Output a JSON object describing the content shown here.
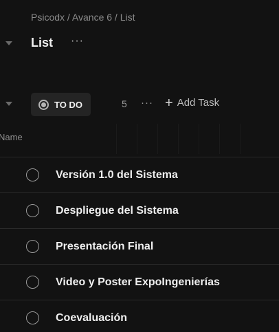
{
  "breadcrumb": "Psicodx / Avance 6 / List",
  "list": {
    "title": "List",
    "more": "···"
  },
  "group": {
    "status": "TO DO",
    "count": "5",
    "more": "···",
    "add_task": "Add Task",
    "add_icon": "+"
  },
  "columns": {
    "name": "Name"
  },
  "tasks": [
    {
      "name": "Versión 1.0 del Sistema"
    },
    {
      "name": "Despliegue del Sistema"
    },
    {
      "name": "Presentación Final"
    },
    {
      "name": "Video y Poster ExpoIngenierías"
    },
    {
      "name": "Coevaluación"
    }
  ]
}
